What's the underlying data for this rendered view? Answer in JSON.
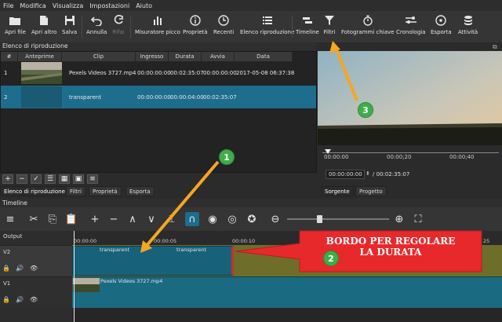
{
  "menu": [
    "File",
    "Modifica",
    "Visualizza",
    "Impostazioni",
    "Aiuto"
  ],
  "toolbar": {
    "open_file": "Apri file",
    "open_other": "Apri altro",
    "save": "Salva",
    "undo": "Annulla",
    "redo": "Rifai",
    "peak_meter": "Misuratore picco",
    "properties": "Proprietà",
    "recent": "Recenti",
    "playlist": "Elenco riproduzione",
    "timeline": "Timeline",
    "filters": "Filtri",
    "keyframes": "Fotogrammi chiave",
    "history": "Cronologia",
    "export": "Esporta",
    "jobs": "Attività"
  },
  "playlist": {
    "title": "Elenco di riproduzione",
    "columns": [
      "#",
      "Anteprime",
      "Clip",
      "Ingresso",
      "Durata",
      "Avvia",
      "Data"
    ],
    "rows": [
      {
        "num": "1",
        "clip": "Pexels Videos 3727.mp4",
        "in": "00:00:00:00",
        "duration": "00:02:35:07",
        "start": "00:00:00:00",
        "date": "2017-05-08 06:37:38"
      },
      {
        "num": "2",
        "clip": "transparent",
        "in": "00:00:00:00",
        "duration": "00:00:04:00",
        "start": "00:02:35:07",
        "date": ""
      }
    ],
    "tabs": [
      "Elenco di riproduzione",
      "Filtri",
      "Proprietà",
      "Esporta"
    ]
  },
  "player": {
    "time_current": "00:00:00:00",
    "time_total": "/ 00:02:35:07",
    "ruler": [
      "00:00:00",
      "00:00;20",
      "00:00;40"
    ],
    "tabs": [
      "Sorgente",
      "Progetto"
    ]
  },
  "timeline": {
    "title": "Timeline",
    "output": "Output",
    "tracks": [
      "V2",
      "V1"
    ],
    "ruler": [
      "00:00:00",
      "00:00:05",
      "00:00:10",
      "25"
    ],
    "clip_v2_a": "transparent",
    "clip_v2_b": "transparent",
    "clip_v1": "Pexels Videos 3727.mp4"
  },
  "callouts": {
    "c1": "1",
    "c2": "2",
    "c3": "3",
    "note_line1": "BORDO PER REGOLARE",
    "note_line2": "LA DURATA"
  },
  "colors": {
    "accent": "#1e6f8f",
    "selected_row": "#1d6d8c",
    "track_v2_bg": "#6e6e2a",
    "clip": "#17627a",
    "callout_box": "#e8292b",
    "arrow": "#f5a623",
    "circle": "#3fae49"
  }
}
